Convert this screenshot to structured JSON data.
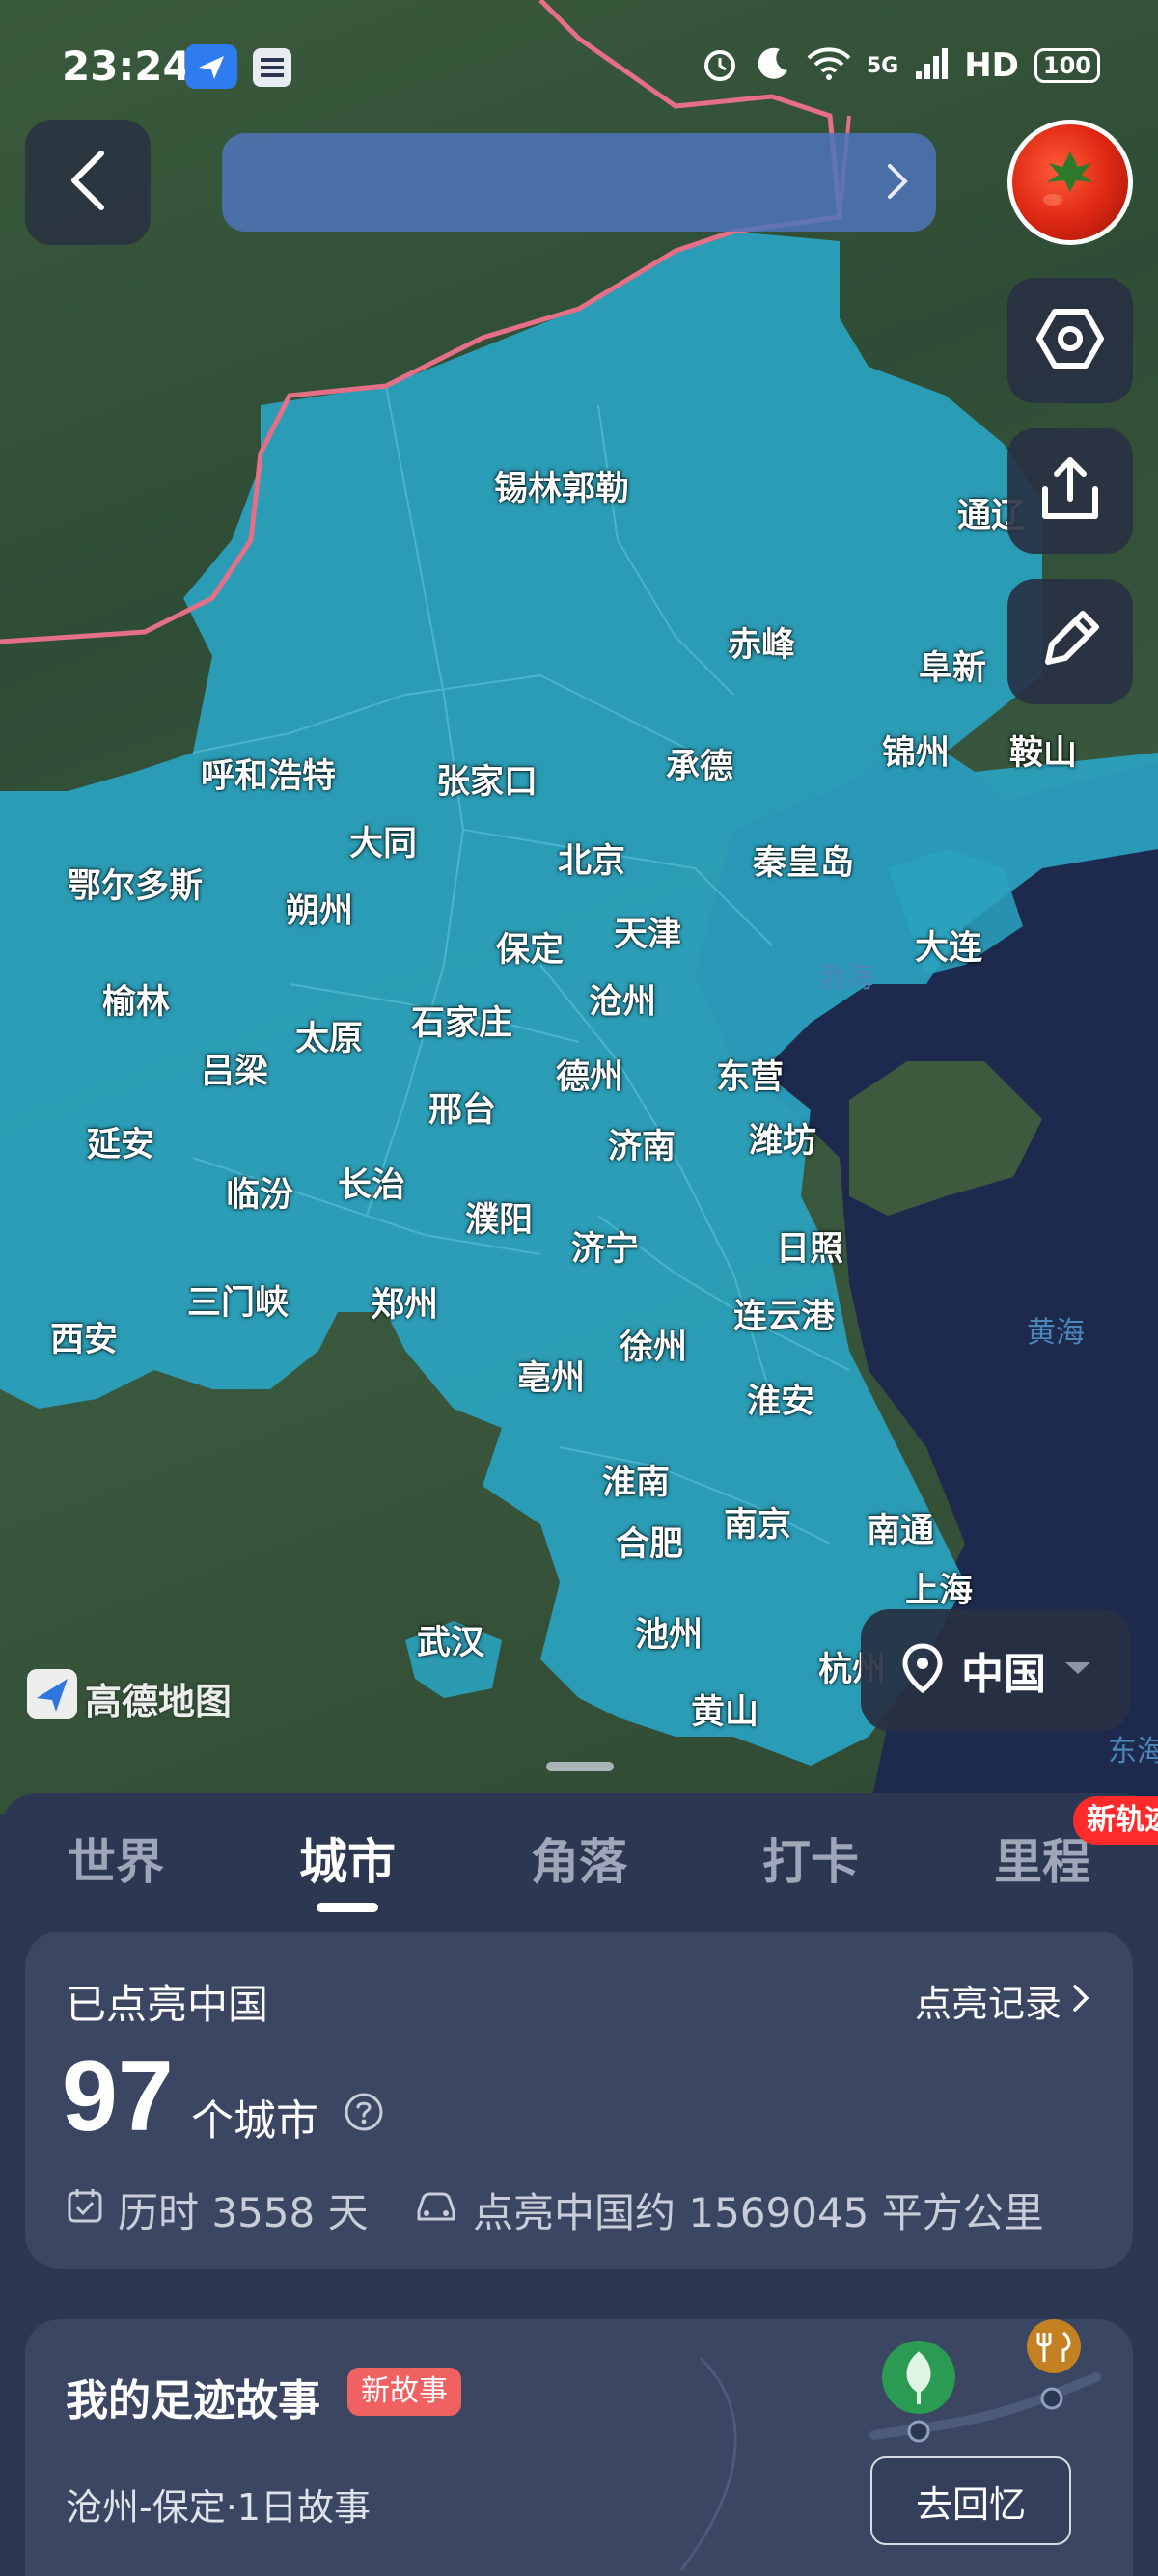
{
  "status_bar": {
    "time": "23:24",
    "network": "5G",
    "hd": "HD",
    "battery": "100"
  },
  "map": {
    "sea_labels": [
      "渤海",
      "黄海",
      "东海"
    ],
    "cities": [
      "锡林郭勒",
      "通辽",
      "赤峰",
      "阜新",
      "锦州",
      "鞍山",
      "呼和浩特",
      "张家口",
      "承德",
      "大同",
      "北京",
      "秦皇岛",
      "鄂尔多斯",
      "朔州",
      "保定",
      "天津",
      "大连",
      "榆林",
      "太原",
      "石家庄",
      "沧州",
      "吕梁",
      "邢台",
      "德州",
      "东营",
      "延安",
      "临汾",
      "长治",
      "济南",
      "潍坊",
      "濮阳",
      "济宁",
      "日照",
      "三门峡",
      "郑州",
      "连云港",
      "西安",
      "亳州",
      "徐州",
      "淮安",
      "淮南",
      "南京",
      "南通",
      "合肥",
      "上海",
      "武汉",
      "池州",
      "杭州",
      "黄山"
    ],
    "brand_name": "高德地图",
    "region_selector": "中国"
  },
  "tabs": [
    {
      "label": "世界",
      "active": false
    },
    {
      "label": "城市",
      "active": true
    },
    {
      "label": "角落",
      "active": false
    },
    {
      "label": "打卡",
      "active": false
    },
    {
      "label": "里程",
      "active": false
    }
  ],
  "new_badge": "新轨迹",
  "stats": {
    "title": "已点亮中国",
    "record_link": "点亮记录",
    "count": "97",
    "unit": "个城市",
    "days": "历时 3558 天",
    "area": "点亮中国约 1569045 平方公里"
  },
  "story": {
    "title": "我的足迹故事",
    "badge": "新故事",
    "subtitle": "沧州-保定·1日故事",
    "button": "去回忆"
  },
  "colors": {
    "lit_region": "#2aa3c0",
    "sheet_bg": "#2c3852",
    "card_bg": "#3a4662",
    "accent_red": "#ff2b2b"
  }
}
